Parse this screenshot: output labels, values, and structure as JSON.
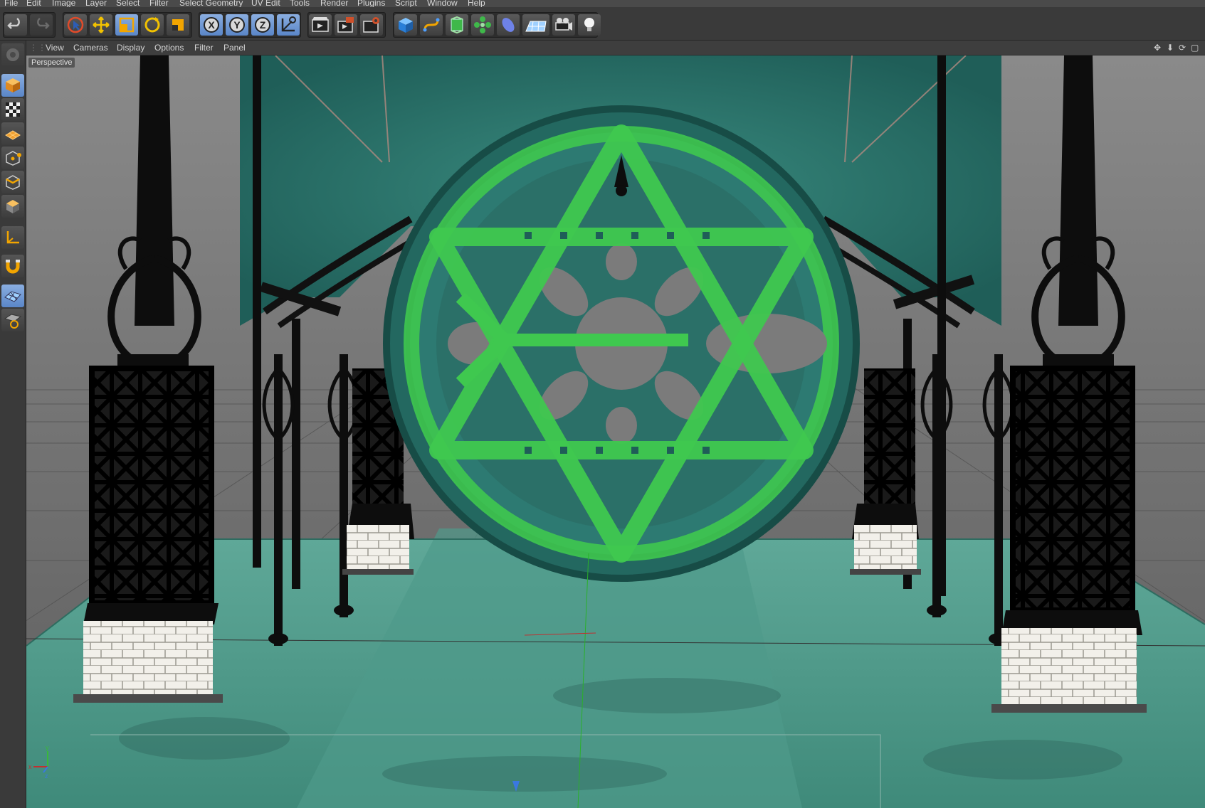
{
  "menubar": {
    "items": [
      "File",
      "Edit",
      "Image",
      "Layer",
      "Select",
      "Filter",
      "Select Geometry",
      "UV Edit",
      "Tools",
      "Render",
      "Plugins",
      "Script",
      "Window",
      "Help"
    ]
  },
  "viewport": {
    "menu": [
      "View",
      "Cameras",
      "Display",
      "Options",
      "Filter",
      "Panel"
    ],
    "label": "Perspective",
    "axes": {
      "x": "x",
      "y": "y",
      "z": "z"
    }
  },
  "toolbar": {
    "axis_x": "X",
    "axis_y": "Y",
    "axis_z": "Z"
  },
  "colors": {
    "accent_active": "#6b93d1",
    "floor": "#4c9c8a",
    "patina": "#2f7d73",
    "ring_green": "#3fc84f"
  },
  "icons": [
    "undo-icon",
    "redo-icon",
    "live-select-icon",
    "move-icon",
    "scale-icon",
    "rotate-icon",
    "recent-tool-icon",
    "x-axis-icon",
    "y-axis-icon",
    "z-axis-icon",
    "coordinate-system-icon",
    "render-view-icon",
    "render-picture-viewer-icon",
    "edit-render-settings-icon",
    "cube-icon",
    "spline-icon",
    "nurbs-icon",
    "array-icon",
    "deformer-icon",
    "floor-icon",
    "camera-icon",
    "light-icon",
    "model-mode-icon",
    "texture-mode-icon",
    "workplane-mode-icon",
    "points-mode-icon",
    "edges-mode-icon",
    "polygons-mode-icon",
    "axis-mode-icon",
    "snap-icon",
    "workplane-icon",
    "locked-workplane-icon"
  ]
}
